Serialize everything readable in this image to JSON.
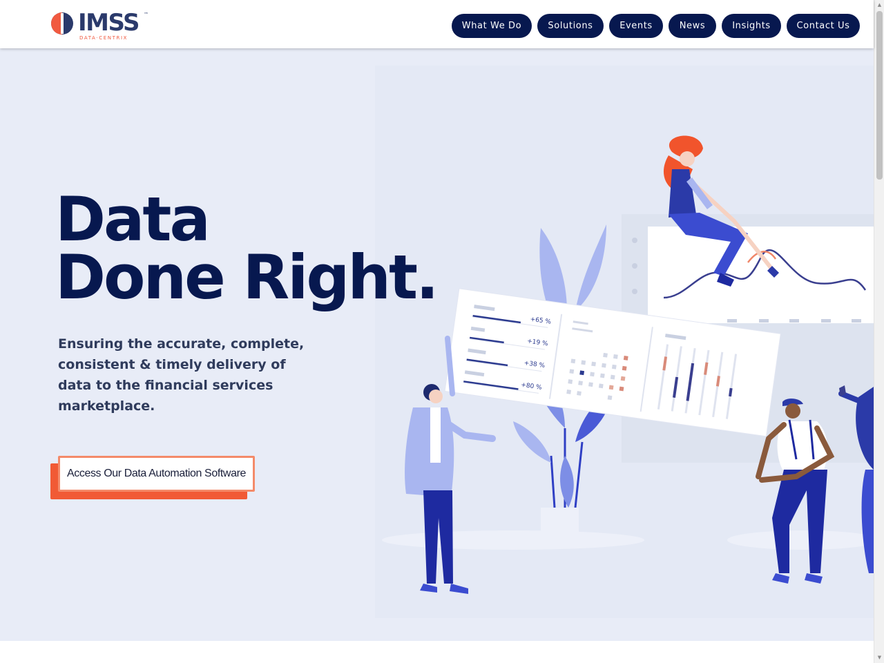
{
  "header": {
    "logo": {
      "name": "IMSS",
      "tm": "™",
      "subtitle": "DATA·CENTRIX"
    },
    "nav": [
      {
        "label": "What We Do"
      },
      {
        "label": "Solutions"
      },
      {
        "label": "Events"
      },
      {
        "label": "News"
      },
      {
        "label": "Insights"
      },
      {
        "label": "Contact Us"
      }
    ]
  },
  "hero": {
    "headline_line1": "Data",
    "headline_line2": "Done Right.",
    "tagline": "Ensuring the accurate, complete, consistent & timely delivery of data to the financial services marketplace.",
    "cta_label": "Access Our Data Automation Software"
  },
  "illustration": {
    "dashboard_stats": [
      "+65 %",
      "+19 %",
      "+38 %",
      "+80 %"
    ]
  },
  "colors": {
    "navy": "#07184f",
    "accent_orange": "#f15a35",
    "hero_bg": "#e8ecf7",
    "illustration_blue": "#2f3fc4"
  }
}
